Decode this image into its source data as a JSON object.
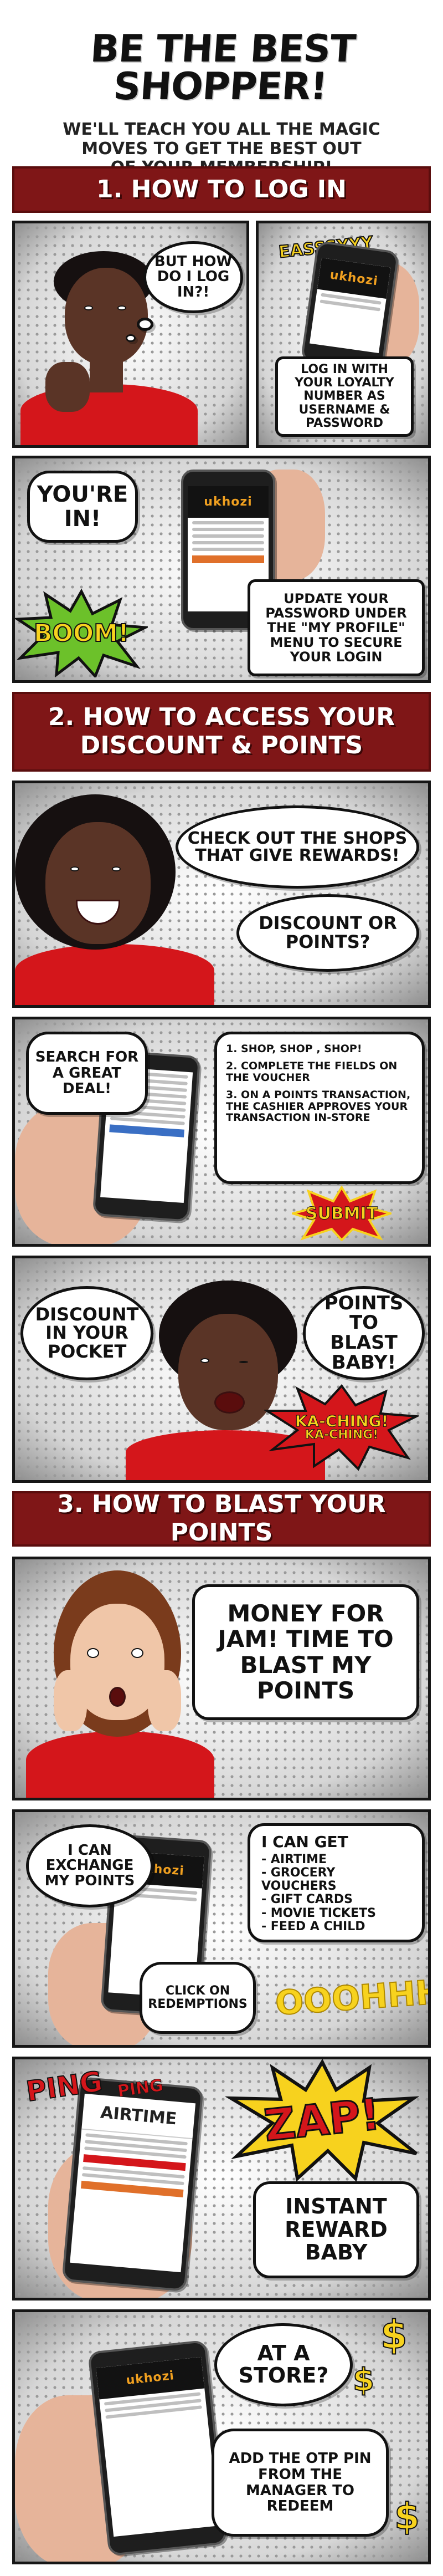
{
  "header": {
    "title": "BE THE BEST SHOPPER!",
    "subtitle_line1": "WE'LL TEACH YOU ALL THE MAGIC",
    "subtitle_line2": "MOVES TO GET THE BEST OUT",
    "subtitle_line3": "OF YOUR MEMBERSHIP!"
  },
  "section1": {
    "banner": "1. HOW TO LOG IN",
    "thought": "BUT HOW DO I LOG IN?!",
    "easy": "EASSSYYY",
    "login_tip": "LOG IN WITH YOUR LOYALTY NUMBER AS USERNAME & PASSWORD",
    "youre_in": "YOU'RE IN!",
    "boom": "BOOM!",
    "password_tip": "UPDATE YOUR PASSWORD UNDER THE \"MY PROFILE\" MENU TO SECURE YOUR LOGIN",
    "phone_logo": "ukhozi"
  },
  "section2": {
    "banner_line1": "2. HOW TO ACCESS YOUR",
    "banner_line2": "DISCOUNT & POINTS",
    "shops_bubble": "CHECK OUT THE SHOPS THAT GIVE REWARDS!",
    "discount_bubble": "DISCOUNT OR POINTS?",
    "search_bubble": "SEARCH FOR A GREAT DEAL!",
    "steps": [
      "1. SHOP, SHOP , SHOP!",
      "2. COMPLETE THE FIELDS ON THE VOUCHER",
      "3. ON A POINTS TRANSACTION, THE CASHIER APPROVES YOUR TRANSACTION IN-STORE"
    ],
    "submit": "SUBMIT",
    "pocket_bubble": "DISCOUNT IN YOUR POCKET",
    "blast_bubble": "POINTS TO BLAST BABY!",
    "kaching1": "KA-CHING!",
    "kaching2": "KA-CHING!"
  },
  "section3": {
    "banner": "3. HOW TO BLAST YOUR POINTS",
    "money_bubble": "MONEY FOR JAM! TIME TO BLAST MY POINTS",
    "exchange_bubble": "I CAN EXCHANGE MY POINTS",
    "get_title": "I CAN GET",
    "get_items": [
      "- AIRTIME",
      "- GROCERY VOUCHERS",
      "- GIFT CARDS",
      "- MOVIE TICKETS",
      "- FEED A CHILD"
    ],
    "redemptions_bubble": "CLICK ON REDEMPTIONS",
    "ooohhh": "OOOHHH",
    "ping1": "PING",
    "ping2": "PING",
    "airtime_screen": "AIRTIME",
    "zap": "ZAP!",
    "instant_bubble": "INSTANT REWARD BABY",
    "store_bubble": "AT A STORE?",
    "otp_bubble": "ADD THE OTP PIN FROM THE MANAGER TO REDEEM",
    "dollar": "$"
  },
  "colors": {
    "banner_red": "#7f1617",
    "shirt_red": "#d4161b",
    "burst_yellow": "#f7d21e",
    "sfx_red": "#d4161b",
    "boom_green": "#6cc12a"
  }
}
